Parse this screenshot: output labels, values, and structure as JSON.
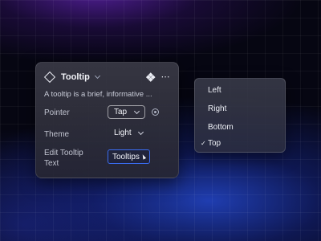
{
  "panel": {
    "title": "Tooltip",
    "description": "A tooltip is a brief, informative ...",
    "more_icon": "⋯",
    "pointer": {
      "label": "Pointer",
      "value": "Tap"
    },
    "theme": {
      "label": "Theme",
      "value": "Light"
    },
    "edit_text": {
      "label_line1": "Edit Tooltip",
      "label_line2": "Text",
      "value": "Tooltips"
    }
  },
  "placement_menu": {
    "items": [
      {
        "label": "Left",
        "selected": false
      },
      {
        "label": "Right",
        "selected": false
      },
      {
        "label": "Bottom",
        "selected": false
      },
      {
        "label": "Top",
        "selected": true
      }
    ],
    "check_mark": "✓"
  },
  "colors": {
    "accent": "#3a6cf0",
    "background": "#060612",
    "glow_blue": "#2850e6",
    "glow_purple": "#6e28c8"
  },
  "icons": [
    "diamond-icon",
    "component-icon",
    "more-icon",
    "chevron-down-icon",
    "target-icon",
    "cursor-icon",
    "check-icon"
  ]
}
